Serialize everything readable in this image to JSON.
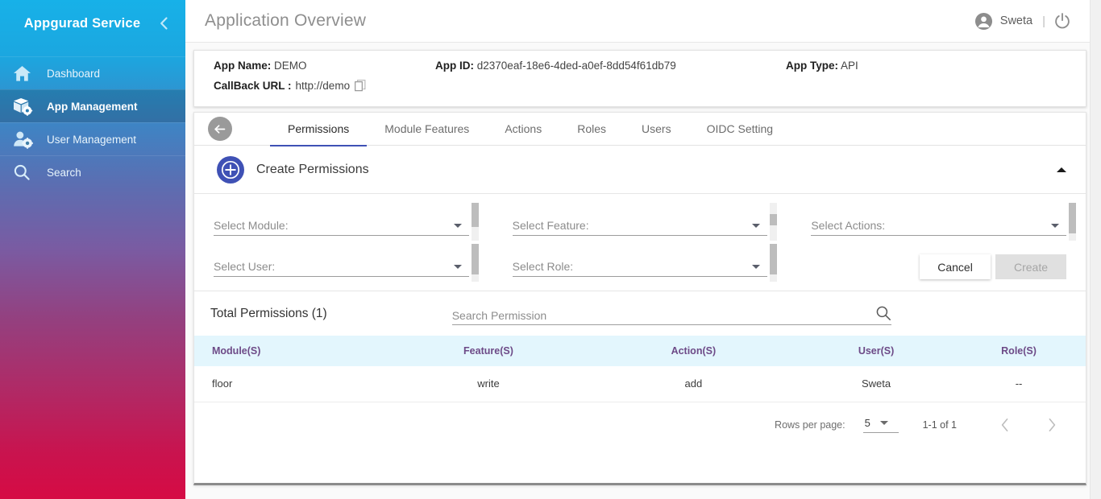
{
  "sidebar": {
    "brand": "Appgurad Service",
    "collapse_icon": "chevron-left-icon",
    "items": [
      {
        "label": "Dashboard",
        "icon": "home-icon",
        "active": false
      },
      {
        "label": "App Management",
        "icon": "package-gear-icon",
        "active": true
      },
      {
        "label": "User Management",
        "icon": "user-gear-icon",
        "active": false
      },
      {
        "label": "Search",
        "icon": "magnifier-icon",
        "active": false
      }
    ]
  },
  "topbar": {
    "title": "Application Overview",
    "user_name": "Sweta",
    "divider": "|",
    "account_icon": "account-circle-icon",
    "power_icon": "power-icon"
  },
  "info": {
    "app_name_label": "App Name:",
    "app_name_value": "DEMO",
    "app_id_label": "App ID:",
    "app_id_value": "d2370eaf-18e6-4ded-a0ef-8dd54f61db79",
    "app_type_label": "App Type:",
    "app_type_value": "API",
    "callback_label": "CallBack URL :",
    "callback_value": "http://demo",
    "copy_icon": "copy-icon"
  },
  "tabs": [
    {
      "label": "Permissions",
      "active": true
    },
    {
      "label": "Module Features",
      "active": false
    },
    {
      "label": "Actions",
      "active": false
    },
    {
      "label": "Roles",
      "active": false
    },
    {
      "label": "Users",
      "active": false
    },
    {
      "label": "OIDC Setting",
      "active": false
    }
  ],
  "back_button_icon": "arrow-left-icon",
  "create_section": {
    "title": "Create Permissions",
    "plus_icon": "plus-circle-icon",
    "collapse_icon": "caret-up-icon",
    "fields": [
      {
        "label": "Select Module:",
        "value": ""
      },
      {
        "label": "Select Feature:",
        "value": ""
      },
      {
        "label": "Select Actions:",
        "value": ""
      },
      {
        "label": "Select User:",
        "value": ""
      },
      {
        "label": "Select Role:",
        "value": ""
      }
    ],
    "cancel_label": "Cancel",
    "create_label": "Create"
  },
  "totals": {
    "label": "Total Permissions (1)",
    "search_placeholder": "Search Permission",
    "search_value": "",
    "search_icon": "search-icon"
  },
  "table": {
    "headers": [
      "Module(S)",
      "Feature(S)",
      "Action(S)",
      "User(S)",
      "Role(S)"
    ],
    "rows": [
      {
        "module": "floor",
        "feature": "write",
        "action": "add",
        "user": "Sweta",
        "role": "--"
      }
    ]
  },
  "pagination": {
    "rows_per_page_label": "Rows per page:",
    "rows_per_page_value": "5",
    "range_label": "1-1 of 1",
    "prev_icon": "chevron-left-icon",
    "next_icon": "chevron-right-icon"
  },
  "colors": {
    "sidebar_top": "#17b1e8",
    "sidebar_bottom": "#d60b44",
    "accent_tab": "#3f51b5",
    "plus_icon": "#3f51b5",
    "table_header_bg": "#e3f6fd",
    "table_header_text": "#6d4a87"
  }
}
